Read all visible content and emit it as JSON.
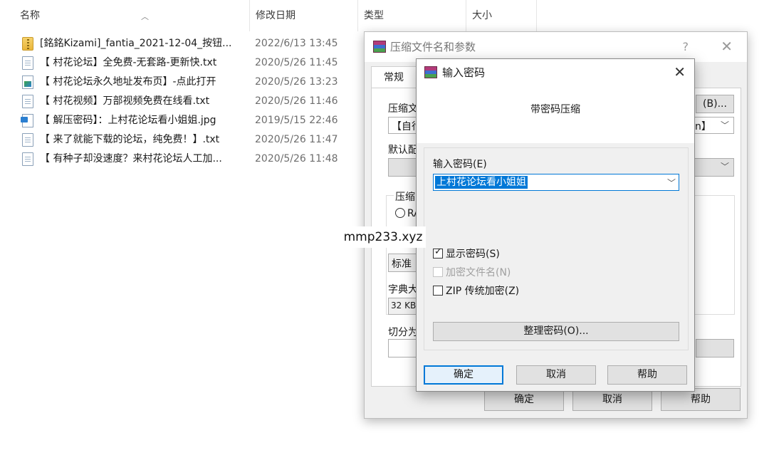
{
  "explorer": {
    "columns": {
      "name": "名称",
      "date": "修改日期",
      "type": "类型",
      "size": "大小"
    },
    "files": [
      {
        "icon": "zip-folder-icon",
        "name": "[銘銘Kizami]_fantia_2021-12-04_按钮...",
        "date": "2022/6/13 13:45"
      },
      {
        "icon": "text-file-icon",
        "name": "【 村花论坛】全免费-无套路-更新快.txt",
        "date": "2020/5/26 11:45"
      },
      {
        "icon": "shortcut-file-icon",
        "name": "【 村花论坛永久地址发布页】-点此打开",
        "date": "2020/5/26 13:23"
      },
      {
        "icon": "text-file-icon",
        "name": "【 村花视频】万部视频免费在线看.txt",
        "date": "2020/5/26 11:46"
      },
      {
        "icon": "image-file-icon",
        "name": "【 解压密码】：上村花论坛看小姐姐.jpg",
        "date": "2019/5/15 22:46"
      },
      {
        "icon": "text-file-icon",
        "name": "【 来了就能下载的论坛，纯免费！】.txt",
        "date": "2020/5/26 11:47"
      },
      {
        "icon": "text-file-icon",
        "name": "【 有种子却没速度？来村花论坛人工加...",
        "date": "2020/5/26 11:48"
      }
    ]
  },
  "back_dialog": {
    "title": "压缩文件名和参数",
    "help_glyph": "?",
    "close_glyph": "✕",
    "tab": "常规",
    "archive_label": "压缩文",
    "browse_button": "(B)...",
    "archive_name_prefix": "【自行",
    "archive_name_suffix": "n】",
    "default_profile_label": "默认配",
    "format_group": "压缩",
    "format_radio": "RA",
    "method": "标准",
    "dict_label": "字典大",
    "dict_value": "32 KB",
    "split_label": "切分为",
    "ok": "确定",
    "cancel": "取消",
    "help": "帮助"
  },
  "front_dialog": {
    "title": "输入密码",
    "close_glyph": "✕",
    "heading": "带密码压缩",
    "password_label": "输入密码(E)",
    "password_value": "上村花论坛看小姐姐",
    "show_password": {
      "label": "显示密码(S)",
      "checked": true
    },
    "encrypt_names": {
      "label": "加密文件名(N)",
      "checked": false,
      "disabled": true
    },
    "zip_legacy": {
      "label": "ZIP 传统加密(Z)",
      "checked": false
    },
    "organize": "整理密码(O)...",
    "ok": "确定",
    "cancel": "取消",
    "help": "帮助"
  },
  "watermark": "mmp233.xyz",
  "colors": {
    "accent": "#0078d7",
    "dialog_bg": "#f0f0f0",
    "button_bg": "#e1e1e1"
  }
}
